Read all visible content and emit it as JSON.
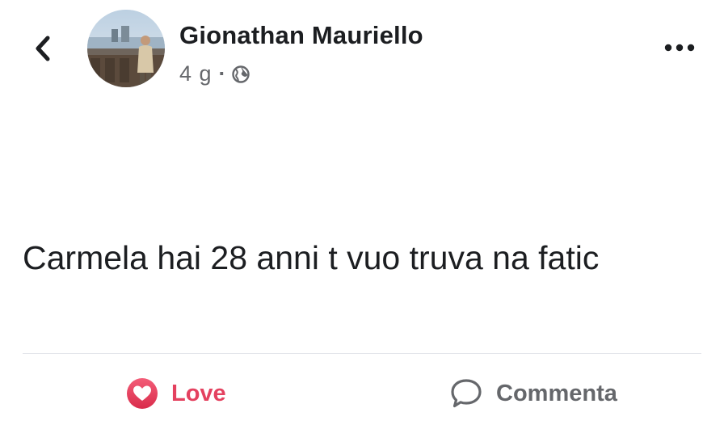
{
  "header": {
    "author_name": "Gionathan Mauriello",
    "time": "4 g",
    "separator": "·",
    "back_icon": "chevron-left-icon",
    "privacy_icon": "globe-icon",
    "more_icon": "more-horizontal-icon"
  },
  "post": {
    "text": "Carmela hai 28 anni t vuo truva na fatic"
  },
  "actions": {
    "love_label": "Love",
    "love_icon": "heart-reaction-icon",
    "comment_label": "Commenta",
    "comment_icon": "comment-bubble-icon"
  },
  "colors": {
    "love": "#e4415f",
    "secondary_text": "#65676b",
    "primary_text": "#1c1e21"
  }
}
